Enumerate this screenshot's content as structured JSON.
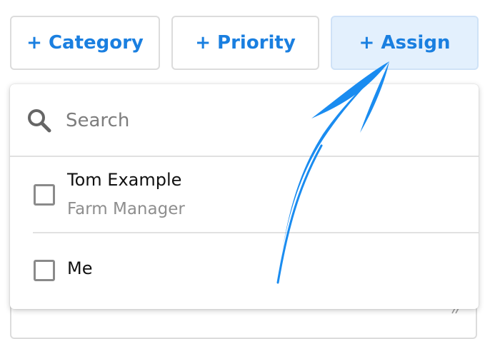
{
  "buttons": {
    "category_label": "+ Category",
    "priority_label": "+ Priority",
    "assign_label": "+ Assign"
  },
  "search": {
    "placeholder": "Search",
    "value": ""
  },
  "assignees": [
    {
      "name": "Tom Example",
      "role": "Farm Manager",
      "checked": false
    },
    {
      "name": "Me",
      "checked": false
    }
  ],
  "icons": {
    "search": "search-icon",
    "checkbox": "checkbox-icon",
    "resize": "resize-handle-icon",
    "annotation": "arrow-icon"
  },
  "colors": {
    "accent": "#1a7fe0",
    "active_button_bg": "#e3f0fd",
    "annotation_arrow": "#1a8cf0",
    "muted_text": "#8e8e8e"
  }
}
